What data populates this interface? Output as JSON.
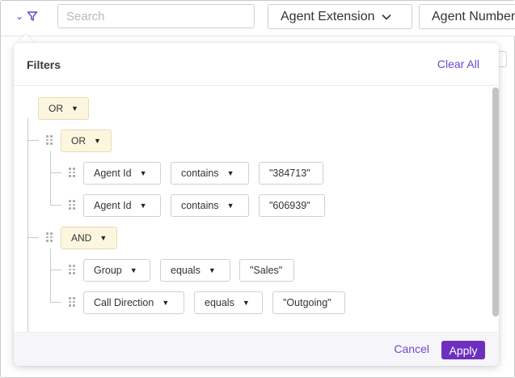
{
  "toolbar": {
    "search_placeholder": "Search",
    "column_selects": [
      {
        "label": "Agent Extension"
      },
      {
        "label": "Agent Number"
      }
    ]
  },
  "filters": {
    "title": "Filters",
    "clear_all": "Clear All",
    "root_operator": "OR",
    "groups": [
      {
        "operator": "OR",
        "conditions": [
          {
            "field": "Agent Id",
            "op": "contains",
            "value": "\"384713\""
          },
          {
            "field": "Agent Id",
            "op": "contains",
            "value": "\"606939\""
          }
        ]
      },
      {
        "operator": "AND",
        "conditions": [
          {
            "field": "Group",
            "op": "equals",
            "value": "\"Sales\""
          },
          {
            "field": "Call Direction",
            "op": "equals",
            "value": "\"Outgoing\""
          }
        ]
      }
    ],
    "cancel": "Cancel",
    "apply": "Apply"
  },
  "colors": {
    "accent": "#6e2fbf",
    "link": "#6f48c9",
    "operator_bg": "#fdf6df"
  },
  "icons": {
    "filter": "filter-funnel-icon",
    "toggle": "chevron-down-icon",
    "select_arrow": "chevron-down-icon",
    "drag": "drag-handle-icon",
    "caret": "caret-down-icon"
  }
}
